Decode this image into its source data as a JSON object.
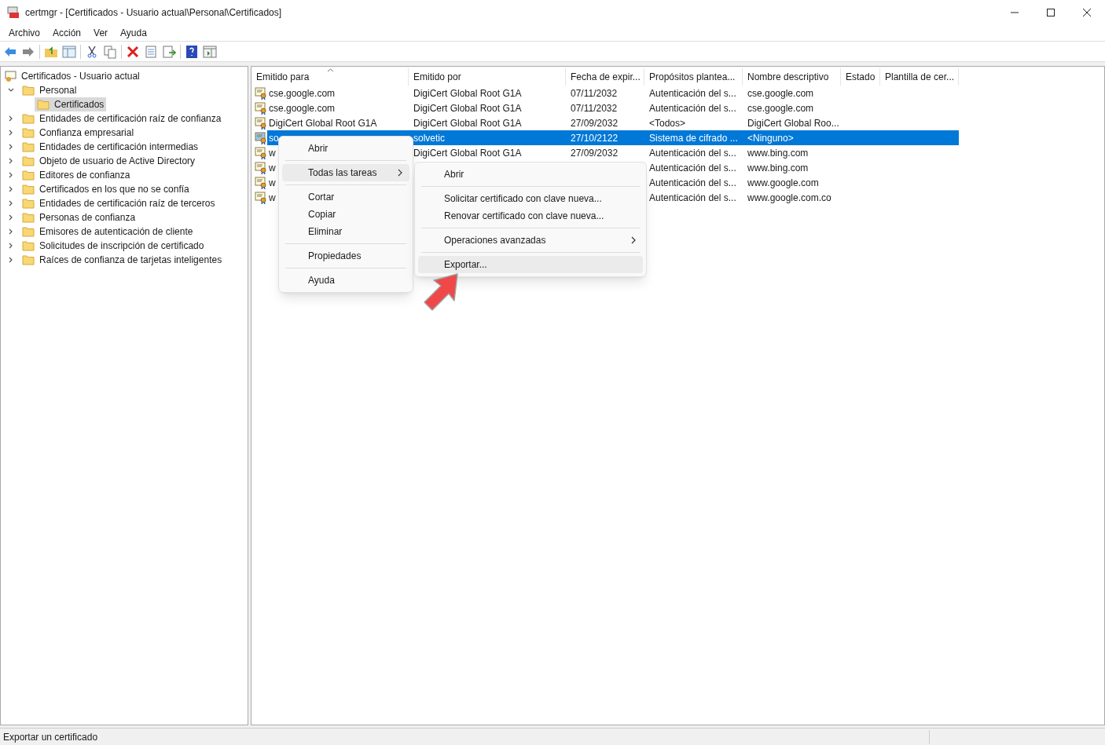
{
  "window": {
    "title": "certmgr - [Certificados - Usuario actual\\Personal\\Certificados]"
  },
  "menu_bar": [
    "Archivo",
    "Acción",
    "Ver",
    "Ayuda"
  ],
  "tree": {
    "root": "Certificados - Usuario actual",
    "items": [
      {
        "label": "Personal",
        "expanded": true,
        "selected": false,
        "children": [
          {
            "label": "Certificados",
            "selected": true
          }
        ]
      },
      {
        "label": "Entidades de certificación raíz de confianza",
        "expanded": false,
        "selected": false
      },
      {
        "label": "Confianza empresarial",
        "expanded": false,
        "selected": false
      },
      {
        "label": "Entidades de certificación intermedias",
        "expanded": false,
        "selected": false
      },
      {
        "label": "Objeto de usuario de Active Directory",
        "expanded": false,
        "selected": false
      },
      {
        "label": "Editores de confianza",
        "expanded": false,
        "selected": false
      },
      {
        "label": "Certificados en los que no se confía",
        "expanded": false,
        "selected": false
      },
      {
        "label": "Entidades de certificación raíz de terceros",
        "expanded": false,
        "selected": false
      },
      {
        "label": "Personas de confianza",
        "expanded": false,
        "selected": false
      },
      {
        "label": "Emisores de autenticación de cliente",
        "expanded": false,
        "selected": false
      },
      {
        "label": "Solicitudes de inscripción de certificado",
        "expanded": false,
        "selected": false
      },
      {
        "label": "Raíces de confianza de tarjetas inteligentes",
        "expanded": false,
        "selected": false
      }
    ]
  },
  "table": {
    "columns": [
      "Emitido para",
      "Emitido por",
      "Fecha de expir...",
      "Propósitos plantea...",
      "Nombre descriptivo",
      "Estado",
      "Plantilla de cer..."
    ],
    "rows": [
      {
        "selected": false,
        "cells": [
          "cse.google.com",
          "DigiCert Global Root G1A",
          "07/11/2032",
          "Autenticación del s...",
          "cse.google.com"
        ]
      },
      {
        "selected": false,
        "cells": [
          "cse.google.com",
          "DigiCert Global Root G1A",
          "07/11/2032",
          "Autenticación del s...",
          "cse.google.com"
        ]
      },
      {
        "selected": false,
        "cells": [
          "DigiCert Global Root G1A",
          "DigiCert Global Root G1A",
          "27/09/2032",
          "<Todos>",
          "DigiCert Global Roo..."
        ]
      },
      {
        "selected": true,
        "cells": [
          "so",
          "solvetic",
          "27/10/2122",
          "Sistema de cifrado ...",
          "<Ninguno>"
        ]
      },
      {
        "selected": false,
        "cells": [
          "w",
          "DigiCert Global Root G1A",
          "27/09/2032",
          "Autenticación del s...",
          "www.bing.com"
        ]
      },
      {
        "selected": false,
        "cells": [
          "w",
          null,
          null,
          "Autenticación del s...",
          "www.bing.com"
        ]
      },
      {
        "selected": false,
        "cells": [
          "w",
          null,
          null,
          "Autenticación del s...",
          "www.google.com"
        ]
      },
      {
        "selected": false,
        "cells": [
          "w",
          null,
          null,
          "Autenticación del s...",
          "www.google.com.co"
        ]
      }
    ]
  },
  "context_menu": {
    "items": [
      {
        "kind": "item",
        "label": "Abrir",
        "has_submenu": false,
        "selected": false
      },
      {
        "kind": "separator"
      },
      {
        "kind": "item",
        "label": "Todas las tareas",
        "has_submenu": true,
        "selected": true
      },
      {
        "kind": "separator"
      },
      {
        "kind": "item",
        "label": "Cortar",
        "has_submenu": false,
        "selected": false
      },
      {
        "kind": "item",
        "label": "Copiar",
        "has_submenu": false,
        "selected": false
      },
      {
        "kind": "item",
        "label": "Eliminar",
        "has_submenu": false,
        "selected": false
      },
      {
        "kind": "separator"
      },
      {
        "kind": "item",
        "label": "Propiedades",
        "has_submenu": false,
        "selected": false
      },
      {
        "kind": "separator"
      },
      {
        "kind": "item",
        "label": "Ayuda",
        "has_submenu": false,
        "selected": false
      }
    ]
  },
  "submenu": {
    "items": [
      {
        "kind": "item",
        "label": "Abrir",
        "has_submenu": false,
        "selected": false
      },
      {
        "kind": "separator"
      },
      {
        "kind": "item",
        "label": "Solicitar certificado con clave nueva...",
        "has_submenu": false,
        "selected": false
      },
      {
        "kind": "item",
        "label": "Renovar certificado con clave nueva...",
        "has_submenu": false,
        "selected": false
      },
      {
        "kind": "separator"
      },
      {
        "kind": "item",
        "label": "Operaciones avanzadas",
        "has_submenu": true,
        "selected": false
      },
      {
        "kind": "separator"
      },
      {
        "kind": "item",
        "label": "Exportar...",
        "has_submenu": false,
        "selected": true
      }
    ]
  },
  "status_bar": "Exportar un certificado"
}
